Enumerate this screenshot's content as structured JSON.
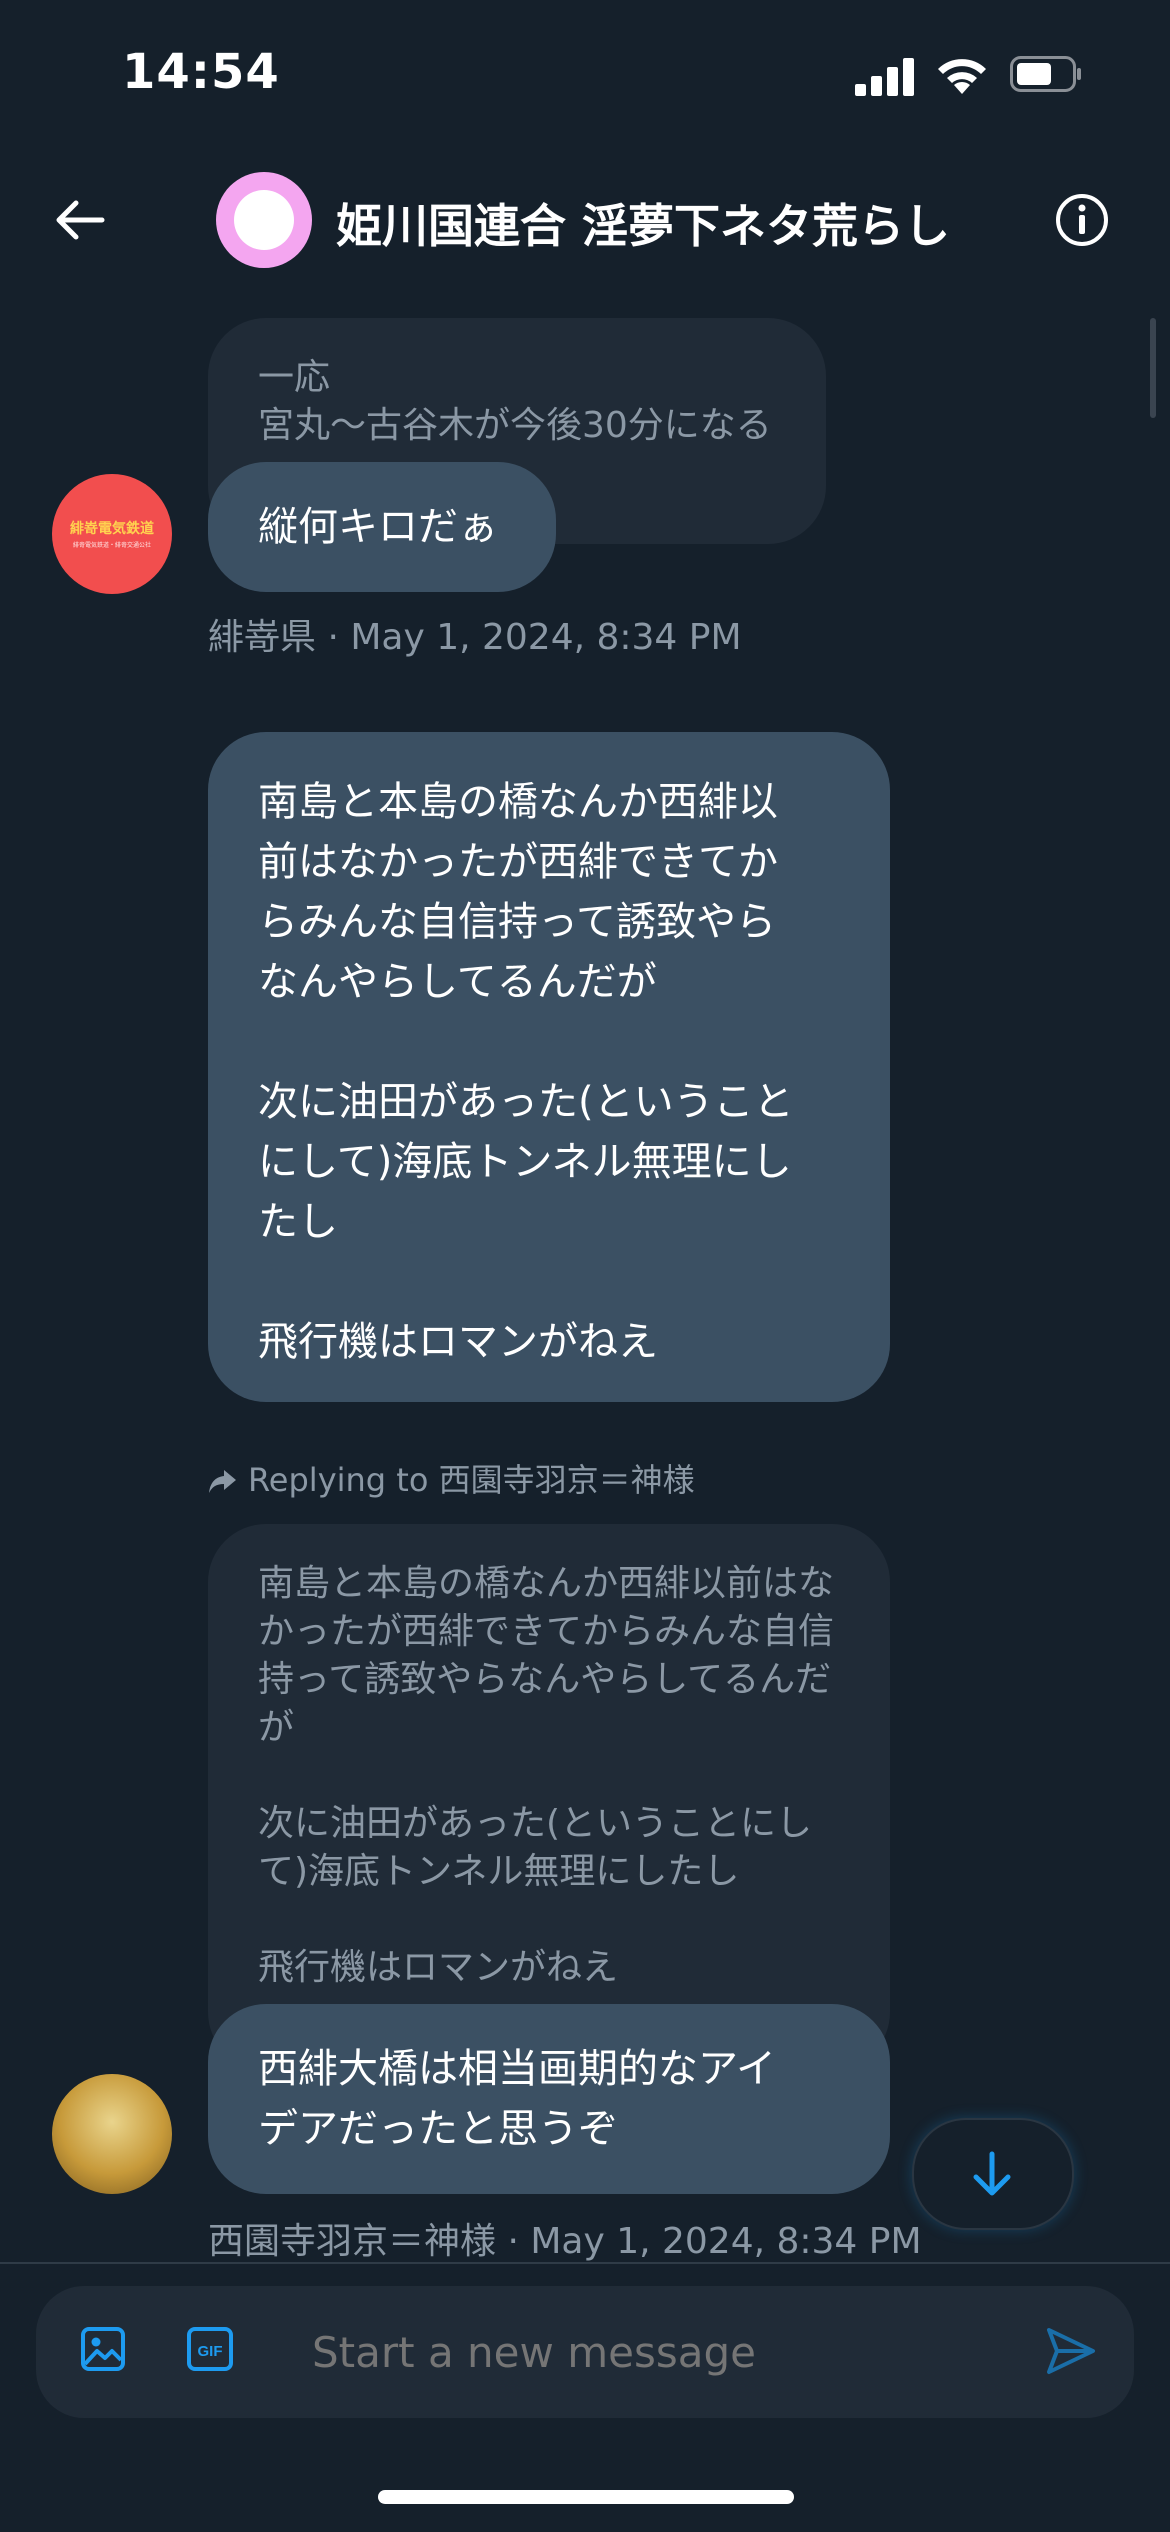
{
  "status": {
    "time": "14:54"
  },
  "header": {
    "title": "姫川国連合 淫夢下ネタ荒らし"
  },
  "messages": [
    {
      "quote": "一応\n宮丸〜古谷木が今後30分になる",
      "text": "縦何キロだぁ",
      "meta": "緋嵜県 · May 1, 2024, 8:34 PM",
      "avatar_text": "緋嵜電気鉄道",
      "avatar_subtext": "緋嵜電気鉄道・緋嵜交通公社"
    },
    {
      "text": "南島と本島の橋なんか西緋以\n前はなかったが西緋できてか\nらみんな自信持って誘致やら\nなんやらしてるんだが\n\n次に油田があった(ということ\nにして)海底トンネル無理にし\nたし\n\n飛行機はロマンがねえ"
    },
    {
      "reply_to": "Replying to 西園寺羽京＝神様",
      "quote": "南島と本島の橋なんか西緋以前はな\nかったが西緋できてからみんな自信\n持って誘致やらなんやらしてるんだ\nが\n\n次に油田があった(ということにし\nて)海底トンネル無理にしたし\n\n飛行機はロマンがねえ",
      "text": "西緋大橋は相当画期的なアイ\nデアだったと思うぞ",
      "meta": "西園寺羽京＝神様 · May 1, 2024, 8:34 PM"
    }
  ],
  "composer": {
    "placeholder": "Start a new message"
  },
  "icons": {
    "back": "arrow-left-icon",
    "info": "info-icon",
    "image": "image-icon",
    "gif": "gif-icon",
    "send": "send-icon",
    "scroll_down": "arrow-down-icon",
    "reply": "reply-arrow-icon"
  },
  "colors": {
    "background": "#15202b",
    "bubble": "#3b5063",
    "quote_bubble": "#202b37",
    "accent": "#1d9bf0",
    "muted_text": "#8b98a5"
  }
}
